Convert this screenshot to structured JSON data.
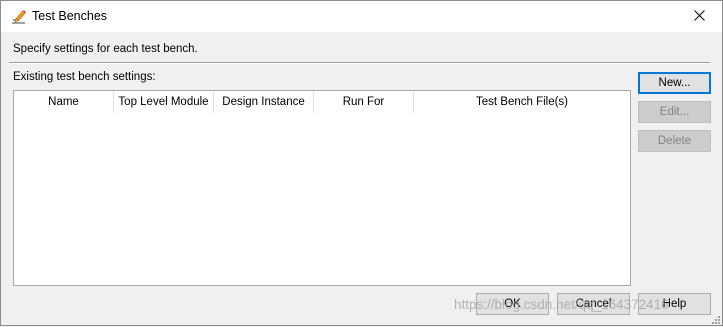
{
  "window": {
    "title": "Test Benches",
    "title_icon": "pencil-icon",
    "close_icon": "close-icon"
  },
  "instructions": "Specify settings for each test bench.",
  "group_label": "Existing test bench settings:",
  "table": {
    "columns": [
      "Name",
      "Top Level Module",
      "Design Instance",
      "Run For",
      "Test Bench File(s)"
    ],
    "rows": []
  },
  "side_buttons": {
    "new": "New...",
    "edit": "Edit...",
    "delete": "Delete"
  },
  "footer_buttons": {
    "ok": "OK",
    "cancel": "Cancel",
    "help": "Help"
  },
  "watermark": "https://blog.csdn.net/qq_164372416",
  "colors": {
    "default_button_border": "#0078d7",
    "dialog_background": "#f0f0f0",
    "title_background": "#ffffff"
  }
}
